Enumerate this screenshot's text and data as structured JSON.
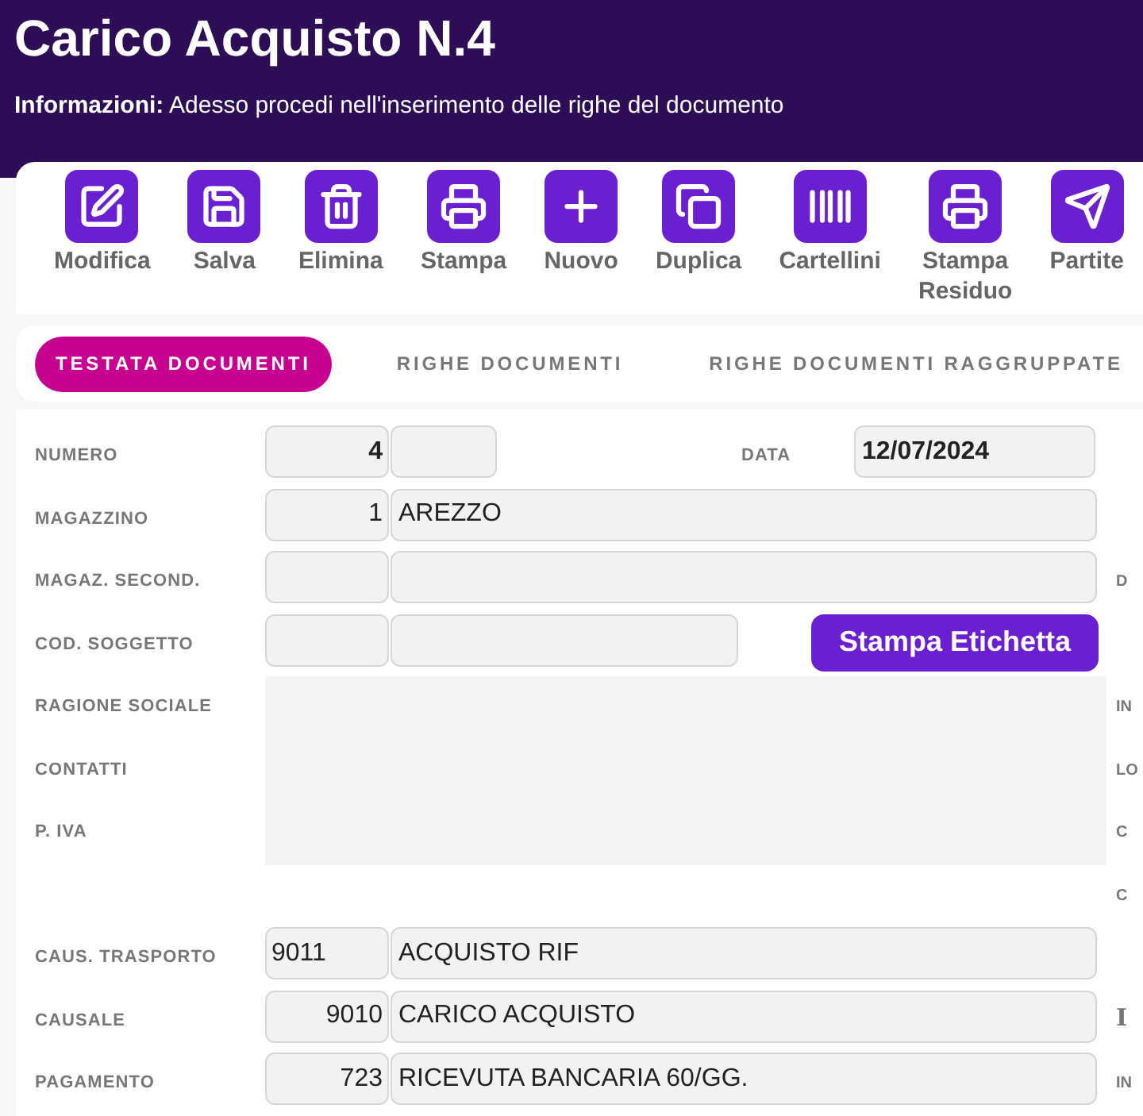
{
  "header": {
    "title": "Carico Acquisto N.4",
    "info_label": "Informazioni:",
    "info_text": "Adesso procedi nell'inserimento delle righe del documento"
  },
  "toolbar": [
    {
      "kind": "edit",
      "label": "Modifica"
    },
    {
      "kind": "save",
      "label": "Salva"
    },
    {
      "kind": "delete",
      "label": "Elimina"
    },
    {
      "kind": "print",
      "label": "Stampa"
    },
    {
      "kind": "new",
      "label": "Nuovo"
    },
    {
      "kind": "duplicate",
      "label": "Duplica"
    },
    {
      "kind": "barcode",
      "label": "Cartellini"
    },
    {
      "kind": "print",
      "label": "Stampa Residuo"
    },
    {
      "kind": "send",
      "label": "Partite"
    }
  ],
  "tabs": [
    {
      "label": "TESTATA DOCUMENTI",
      "selected": true
    },
    {
      "label": "RIGHE DOCUMENTI",
      "selected": false
    },
    {
      "label": "RIGHE DOCUMENTI RAGGRUPPATE",
      "selected": false
    }
  ],
  "form": [
    {
      "kind": "numero",
      "label": "NUMERO",
      "code": "4",
      "date_label": "DATA",
      "date": "12/07/2024"
    },
    {
      "kind": "code_desc",
      "label": "MAGAZZINO",
      "code": "1",
      "desc": "AREZZO"
    },
    {
      "kind": "code_desc",
      "label": "MAGAZ. SECOND.",
      "side": "D"
    },
    {
      "kind": "soggetto",
      "label": "COD. SOGGETTO",
      "button": "Stampa Etichetta"
    },
    {
      "kind": "masked",
      "label": "RAGIONE SOCIALE",
      "side": "IN"
    },
    {
      "kind": "masked",
      "label": "CONTATTI",
      "side": "LO"
    },
    {
      "kind": "masked",
      "label": "P. IVA",
      "side": "C"
    },
    {
      "kind": "blank",
      "side": "C"
    },
    {
      "kind": "code_desc",
      "label": "CAUS. TRASPORTO",
      "code": "9011",
      "code_left": true,
      "desc": "ACQUISTO RIF"
    },
    {
      "kind": "code_desc",
      "label": "CAUSALE",
      "code": "9010",
      "desc": "CARICO ACQUISTO",
      "side": "I",
      "side_serif": true
    },
    {
      "kind": "code_desc",
      "label": "PAGAMENTO",
      "code": "723",
      "desc": "RICEVUTA BANCARIA 60/GG.",
      "side": "IN"
    }
  ]
}
